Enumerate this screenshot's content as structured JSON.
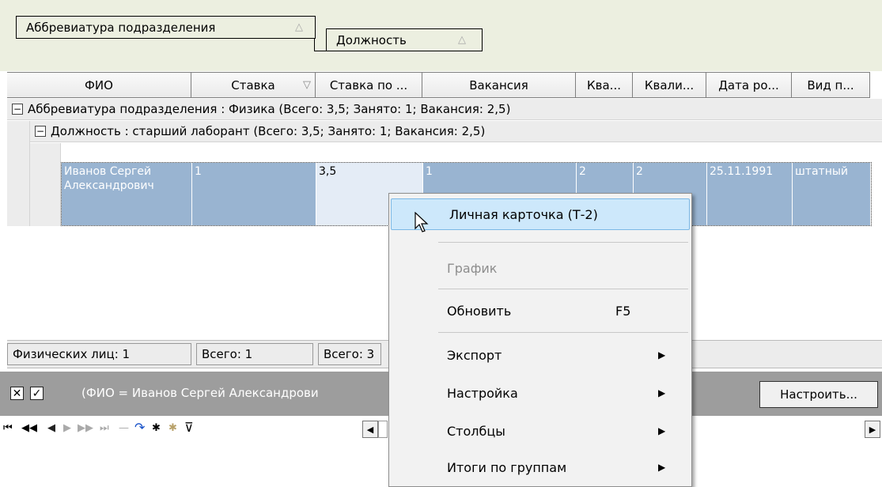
{
  "group_panel": {
    "group1": "Аббревиатура подразделения",
    "group2": "Должность",
    "sort_glyph": "△"
  },
  "columns": [
    {
      "label": "ФИО"
    },
    {
      "label": "Ставка",
      "sort": "▽"
    },
    {
      "label": "Ставка по ..."
    },
    {
      "label": "Вакансия"
    },
    {
      "label": "Ква..."
    },
    {
      "label": "Квали..."
    },
    {
      "label": "Дата ро..."
    },
    {
      "label": "Вид п..."
    }
  ],
  "group_rows": {
    "level1": "Аббревиатура подразделения : Физика (Всего: 3,5; Занято: 1; Вакансия: 2,5)",
    "level2": "Должность : старший лаборант (Всего: 3,5; Занято: 1; Вакансия: 2,5)",
    "toggle": "−"
  },
  "data_row": {
    "fio": "Иванов Сергей Александрович",
    "stavka": "1",
    "stavka_po": "3,5",
    "vakansiya": "1",
    "kva": "2",
    "kvali": "2",
    "data_ro": "25.11.1991",
    "vid_p": "штатный"
  },
  "footer": {
    "phys": "Физических лиц: 1",
    "total1": "Всего: 1",
    "total2": "Всего: 3"
  },
  "filter": {
    "text": "(ФИО = Иванов Сергей Александрови",
    "close_glyph": "✕",
    "check_glyph": "✓",
    "config_button": "Настроить..."
  },
  "navigator": {
    "first": "⏮",
    "prev_page": "◀◀",
    "prev": "◀",
    "next": "▶",
    "next_page": "▶▶",
    "last": "⏭",
    "delete": "—",
    "refresh": "↷",
    "insert": "✱",
    "edit": "✱",
    "filter": "⊽",
    "scroll_left": "◀",
    "scroll_right": "▶"
  },
  "context_menu": {
    "items": [
      {
        "label": "Личная карточка (Т-2)"
      },
      {
        "label": "График"
      },
      {
        "label": "Обновить",
        "shortcut": "F5"
      },
      {
        "label": "Экспорт",
        "submenu": "▶"
      },
      {
        "label": "Настройка",
        "submenu": "▶"
      },
      {
        "label": "Столбцы",
        "submenu": "▶"
      },
      {
        "label": "Итоги по группам",
        "submenu": "▶"
      }
    ]
  },
  "colors": {
    "group_panel_bg": "#ecefe0",
    "selection": "#99b4d1",
    "menu_highlight": "#cde8fb",
    "filter_bar": "#9d9d9d"
  }
}
